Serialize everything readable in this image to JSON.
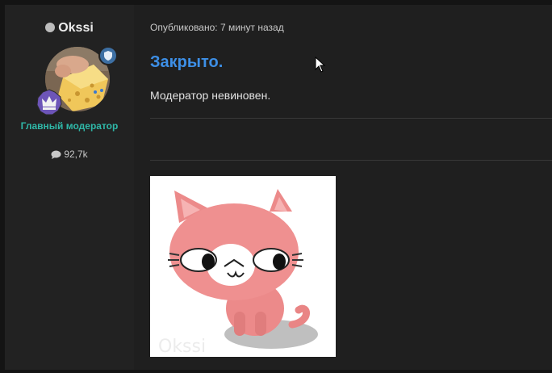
{
  "user": {
    "name": "Okssi",
    "role": "Главный модератор",
    "message_count": "92,7k",
    "status": "offline"
  },
  "post": {
    "meta": "Опубликовано: 7 минут назад",
    "title": "Закрыто.",
    "body": "Модератор невиновен."
  },
  "icons": {
    "status": "status-dot-icon",
    "badge_shield": "shield-badge-icon",
    "badge_crown": "crown-badge-icon",
    "messages": "speech-bubble-icon"
  },
  "colors": {
    "title": "#3d8fe6",
    "role": "#2fb8a8",
    "background": "#1d1d1d"
  }
}
